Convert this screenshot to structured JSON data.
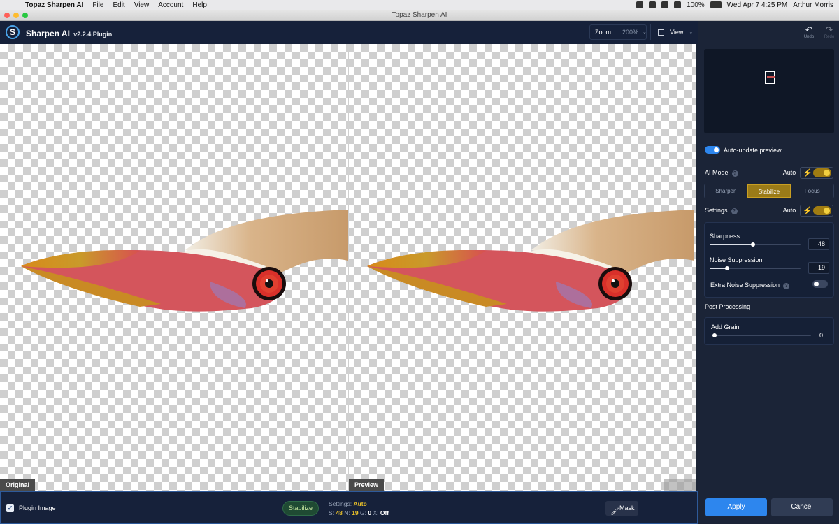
{
  "menubar": {
    "app_name": "Topaz Sharpen AI",
    "items": [
      "File",
      "Edit",
      "View",
      "Account",
      "Help"
    ],
    "battery": "100%",
    "datetime": "Wed Apr 7  4:25 PM",
    "user": "Arthur Morris"
  },
  "window": {
    "title": "Topaz Sharpen AI"
  },
  "header": {
    "app_title": "Sharpen AI",
    "version": "v2.2.4 Plugin",
    "zoom_label": "Zoom",
    "zoom_value": "200%",
    "view_label": "View"
  },
  "canvas": {
    "original_label": "Original",
    "preview_label": "Preview"
  },
  "bottombar": {
    "plugin_image_label": "Plugin Image",
    "mode_pill": "Stabilize",
    "settings_label": "Settings:",
    "settings_value": "Auto",
    "s_label": "S:",
    "s_value": "48",
    "n_label": "N:",
    "n_value": "19",
    "g_label": "G:",
    "g_value": "0",
    "x_label": "X:",
    "x_value": "Off",
    "mask_label": "Mask"
  },
  "panel": {
    "undo_label": "Undo",
    "redo_label": "Redo",
    "auto_update_label": "Auto-update preview",
    "auto_update_on": true,
    "ai_mode_label": "AI Mode",
    "ai_mode_auto_label": "Auto",
    "modes": [
      "Sharpen",
      "Stabilize",
      "Focus"
    ],
    "active_mode": "Stabilize",
    "settings_label": "Settings",
    "settings_auto_label": "Auto",
    "sharpness_label": "Sharpness",
    "sharpness_value": "48",
    "sharpness_fraction": 0.48,
    "noise_label": "Noise Suppression",
    "noise_value": "19",
    "noise_fraction": 0.19,
    "extra_noise_label": "Extra Noise Suppression",
    "extra_noise_on": false,
    "post_processing_label": "Post Processing",
    "grain_label": "Add Grain",
    "grain_value": "0",
    "grain_fraction": 0,
    "apply_label": "Apply",
    "cancel_label": "Cancel"
  },
  "colors": {
    "accent_blue": "#2d86ee",
    "auto_gold": "#9b7b18",
    "panel_bg": "#1b2437"
  }
}
